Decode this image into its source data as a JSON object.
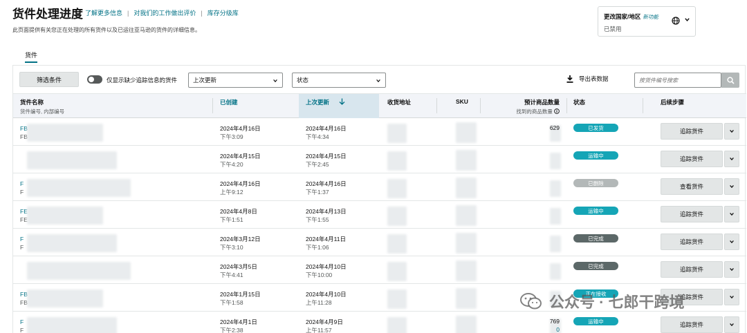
{
  "header": {
    "title": "货件处理进度",
    "links": [
      "了解更多信息",
      "对我们的工作做出评价",
      "库存分级库"
    ],
    "description": "此页面提供有关您正在处理的所有货件以及已运往亚马逊的货件的详细信息。"
  },
  "region": {
    "label": "更改国家/地区",
    "beta": "新功能",
    "status": "已禁用"
  },
  "tabs": [
    {
      "label": "货件"
    }
  ],
  "toolbar": {
    "filter_button": "筛选条件",
    "toggle_label": "仅显示缺少追踪信息的货件",
    "sort_select": "上次更新",
    "status_select": "状态",
    "export_label": "导出表数据",
    "search_placeholder": "按货件编号搜索"
  },
  "table": {
    "columns": {
      "name": "货件名称",
      "name_sub": "货件编号, 内部编号",
      "created": "已创建",
      "updated": "上次更新",
      "address": "收货地址",
      "sku": "SKU",
      "expected": "预计商品数量",
      "expected_sub": "找到的商品数量",
      "status": "状态",
      "next": "后续步骤"
    },
    "rows": [
      {
        "name": "FB",
        "id": "FB",
        "created_date": "2024年4月16日",
        "created_time": "下午3:09",
        "updated_date": "2024年4月16日",
        "updated_time": "下午4:34",
        "qty": "629",
        "found": "",
        "status": "已发货",
        "status_color": "#15a5b6",
        "action": "追踪货件"
      },
      {
        "name": "",
        "id": "",
        "created_date": "2024年4月15日",
        "created_time": "下午4:20",
        "updated_date": "2024年4月15日",
        "updated_time": "下午2:45",
        "qty": "",
        "found": "",
        "status": "运输中",
        "status_color": "#15a5b6",
        "action": "追踪货件"
      },
      {
        "name": "F",
        "id": "F",
        "created_date": "2024年4月16日",
        "created_time": "上午9:12",
        "updated_date": "2024年4月16日",
        "updated_time": "下午1:37",
        "qty": "",
        "found": "",
        "status": "已删除",
        "status_color": "#b3b8b8",
        "action": "查看货件"
      },
      {
        "name": "FE",
        "id": "FE",
        "created_date": "2024年4月8日",
        "created_time": "下午1:51",
        "updated_date": "2024年4月13日",
        "updated_time": "下午1:55",
        "qty": "",
        "found": "",
        "status": "运输中",
        "status_color": "#15a5b6",
        "action": "追踪货件"
      },
      {
        "name": "F",
        "id": "F",
        "created_date": "2024年3月12日",
        "created_time": "下午3:10",
        "updated_date": "2024年4月11日",
        "updated_time": "下午1:06",
        "qty": "",
        "found": "",
        "status": "已完成",
        "status_color": "#5c6868",
        "action": "追踪货件"
      },
      {
        "name": "",
        "id": "",
        "created_date": "2024年3月5日",
        "created_time": "下午4:41",
        "updated_date": "2024年4月10日",
        "updated_time": "下午10:00",
        "qty": "",
        "found": "",
        "status": "已完成",
        "status_color": "#5c6868",
        "action": "追踪货件"
      },
      {
        "name": "FB",
        "id": "FB",
        "created_date": "2024年1月15日",
        "created_time": "下午1:58",
        "updated_date": "2024年4月10日",
        "updated_time": "上午11:28",
        "qty": "",
        "found": "",
        "status": "正在接收",
        "status_color": "#15a5b6",
        "action": "追踪货件"
      },
      {
        "name": "F",
        "id": "F",
        "created_date": "2024年4月1日",
        "created_time": "下午2:38",
        "updated_date": "2024年4月9日",
        "updated_time": "上午11:57",
        "qty": "769",
        "found": "0",
        "status": "运输中",
        "status_color": "#15a5b6",
        "action": "追踪货件"
      }
    ]
  },
  "watermark": "公众号 · 七郎干跨境",
  "colors": {
    "link": "#007185",
    "accent": "#15a5b6",
    "header_bg": "#f2f4f8"
  }
}
